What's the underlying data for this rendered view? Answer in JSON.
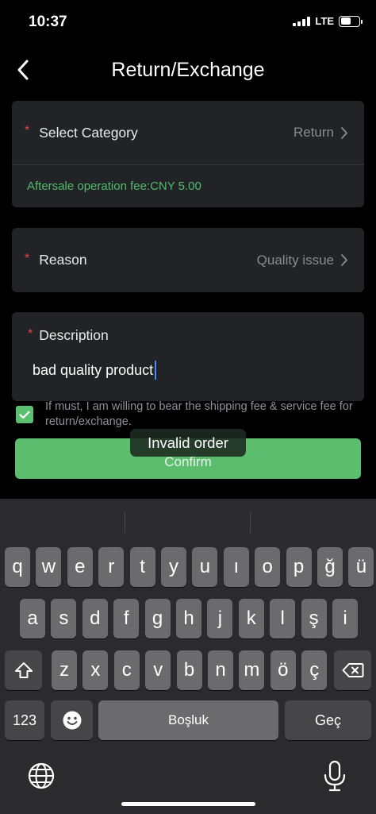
{
  "status": {
    "time": "10:37",
    "network": "LTE"
  },
  "nav": {
    "title": "Return/Exchange"
  },
  "form": {
    "required_mark": "*",
    "category": {
      "label": "Select Category",
      "value": "Return"
    },
    "fee": "Aftersale operation fee:CNY 5.00",
    "reason": {
      "label": "Reason",
      "value": "Quality issue"
    },
    "description": {
      "label": "Description",
      "value": "bad quality product"
    },
    "agree_text": "If must, I am willing to bear the shipping fee & service fee for return/exchange.",
    "agree_checked": true,
    "confirm_label": "Confirm"
  },
  "toast": {
    "text": "Invalid order"
  },
  "keyboard": {
    "row1": [
      "q",
      "w",
      "e",
      "r",
      "t",
      "y",
      "u",
      "ı",
      "o",
      "p",
      "ğ",
      "ü"
    ],
    "row2": [
      "a",
      "s",
      "d",
      "f",
      "g",
      "h",
      "j",
      "k",
      "l",
      "ş",
      "i"
    ],
    "row3": [
      "z",
      "x",
      "c",
      "v",
      "b",
      "n",
      "m",
      "ö",
      "ç"
    ],
    "numbers_label": "123",
    "space_label": "Boşluk",
    "return_label": "Geç"
  },
  "colors": {
    "accent": "#5bbd6d",
    "required": "#e4473f",
    "fee_text": "#4fbd6a",
    "card": "#222326"
  }
}
